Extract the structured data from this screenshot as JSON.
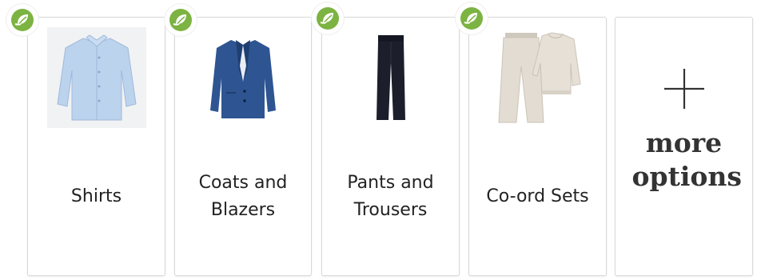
{
  "categories": [
    {
      "label": "Shirts",
      "icon": "shirt-image",
      "badge": "eco-leaf-icon"
    },
    {
      "label": "Coats and Blazers",
      "icon": "blazer-image",
      "badge": "eco-leaf-icon"
    },
    {
      "label": "Pants and Trousers",
      "icon": "trousers-image",
      "badge": "eco-leaf-icon"
    },
    {
      "label": "Co-ord Sets",
      "icon": "coord-set-image",
      "badge": "eco-leaf-icon"
    }
  ],
  "more_options": {
    "label": "more options",
    "icon": "plus-icon"
  },
  "colors": {
    "badge_green": "#7cb342",
    "card_border": "#d9d9d9",
    "text": "#222222",
    "shirt": "#bcd3ee",
    "blazer": "#2e5592",
    "trousers": "#1c1f2b",
    "coord": "#e2dcd3"
  }
}
